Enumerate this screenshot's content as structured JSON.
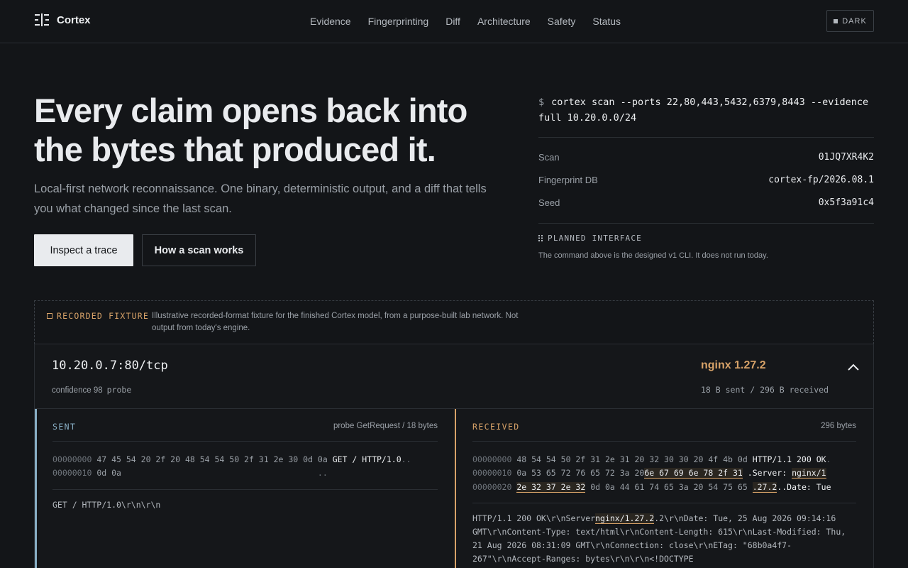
{
  "header": {
    "brand": "Cortex",
    "nav": [
      "Evidence",
      "Fingerprinting",
      "Diff",
      "Architecture",
      "Safety",
      "Status"
    ],
    "theme_label": "DARK"
  },
  "hero": {
    "title": "Every claim opens back into the bytes that produced it.",
    "subtitle": "Local-first network reconnaissance. One binary, deterministic output, and a diff that tells you what changed since the last scan.",
    "primary_button": "Inspect a trace",
    "secondary_button": "How a scan works"
  },
  "command": {
    "prompt": "$",
    "text": "cortex scan --ports 22,80,443,5432,6379,8443 --evidence full 10.20.0.0/24",
    "rows": [
      {
        "key": "Scan",
        "value": "01JQ7XR4K2"
      },
      {
        "key": "Fingerprint DB",
        "value": "cortex-fp/2026.08.1"
      },
      {
        "key": "Seed",
        "value": "0x5f3a91c4"
      }
    ],
    "planned_label": "PLANNED INTERFACE",
    "planned_note": "The command above is the designed v1 CLI. It does not run today."
  },
  "fixture": {
    "label": "RECORDED FIXTURE",
    "text": "Illustrative recorded-format fixture for the finished Cortex model, from a purpose-built lab network. Not output from today's engine."
  },
  "trace": {
    "endpoint": "10.20.0.7:80/tcp",
    "confidence": "confidence 98",
    "method": "probe",
    "service": "nginx 1.27.2",
    "bytes_summary": "18 B sent / 296 B received",
    "sent": {
      "title": "SENT",
      "meta": "probe GetRequest / 18 bytes",
      "rows": [
        {
          "offset": "00000000",
          "hex": "47 45 54 20 2f 20 48 54 54 50 2f 31 2e 30 0d 0a",
          "ascii": "GET / HTTP/1.0",
          "tail": ".."
        },
        {
          "offset": "00000010",
          "hex": "0d 0a",
          "ascii": "",
          "tail": ".."
        }
      ],
      "raw": "GET / HTTP/1.0\\r\\n\\r\\n"
    },
    "received": {
      "title": "RECEIVED",
      "meta": "296 bytes",
      "row1_offset": "00000000",
      "row1_hex": "48 54 54 50 2f 31 2e 31 20 32 30 30 20 4f 4b 0d",
      "row1_ascii": "HTTP/1.1 200 OK",
      "row1_tail": ".",
      "row2_offset": "00000010",
      "row2_hex_a": "0a 53 65 72 76 65 72 3a 20",
      "row2_hex_hl": "6e 67 69 6e 78 2f 31",
      "row2_ascii_a": ".Server: ",
      "row2_ascii_hl": "nginx/1",
      "row3_offset": "00000020",
      "row3_hex_hl": "2e 32 37 2e 32",
      "row3_hex_b": "0d 0a 44 61 74 65 3a 20 54 75 65",
      "row3_ascii_hl": ".27.2",
      "row3_ascii_b": "..Date: Tue",
      "raw_a": "HTTP/1.1 200 OK\\r\\nServer",
      "raw_hl": "nginx/1.27.2",
      "raw_b": ".2\\r\\nDate: Tue, 25 Aug 2026 09:14:16 GMT\\r\\nContent-Type: text/html\\r\\nContent-Length: 615\\r\\nLast-Modified: Thu, 21 Aug 2026 08:31:09 GMT\\r\\nConnection: close\\r\\nETag: \"68b0a4f7-267\"\\r\\nAccept-Ranges: bytes\\r\\n\\r\\n<!DOCTYPE html>\\n<html>\\n<head>\\n<title>Welcome to nginx!"
    }
  },
  "colors": {
    "background": "#131518",
    "accent_amber": "#d7a268",
    "accent_blue": "#88aec4"
  }
}
